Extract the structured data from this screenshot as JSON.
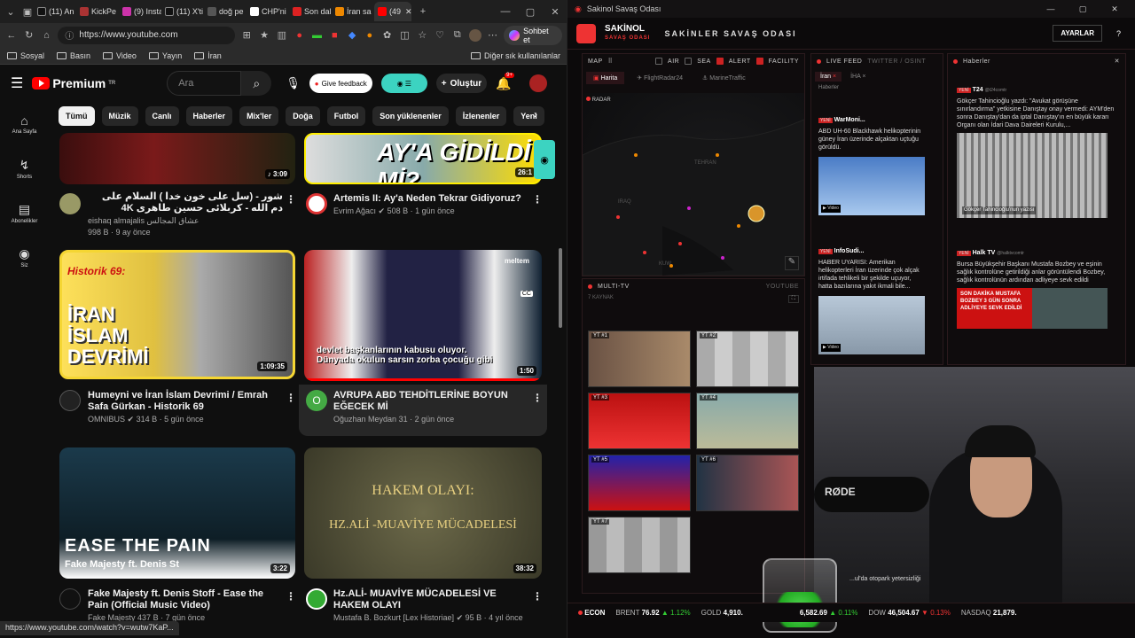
{
  "browser": {
    "tabs": [
      "(11) An",
      "KickPe",
      "(9) Insta",
      "(11) X'ti",
      "doğ pe",
      "CHP'ni",
      "Son dal",
      "İran sa",
      "(49"
    ],
    "address": "https://www.youtube.com",
    "profile_button": "Sohbet et",
    "bookmarks": [
      "Sosyal",
      "Basın",
      "Video",
      "Yayın",
      "İran"
    ],
    "bookmarks_other": "Diğer sık kullanılanlar",
    "status_url": "https://www.youtube.com/watch?v=wutw7KaP..."
  },
  "youtube": {
    "brand": "Premium",
    "brand_region": "TR",
    "search_placeholder": "Ara",
    "feedback": "Give feedback",
    "create": "Oluştur",
    "notif_count": "9+",
    "sidebar": [
      "Ana Sayfa",
      "Shorts",
      "Abonelikler",
      "Siz"
    ],
    "chips": [
      "Tümü",
      "Müzik",
      "Canlı",
      "Haberler",
      "Mix'ler",
      "Doğa",
      "Futbol",
      "Son yüklenenler",
      "İzlenenler",
      "Yeni"
    ],
    "videos": [
      {
        "title": "شور - (سل علی خون خدا ) السلام علی دم الله - کربلائی حسین طاهری 4K",
        "channel": "eishaq almajalis عشاق المجالس",
        "meta": "998 B · 9 ay önce",
        "duration": "3:09"
      },
      {
        "title": "Artemis II: Ay'a Neden Tekrar Gidiyoruz?",
        "channel": "Evrim Ağacı",
        "meta": "508 B · 1 gün önce",
        "duration": "26:1",
        "thumb_text": "AY'A GİDİLDİ Mİ?"
      },
      {
        "title": "Humeyni ve İran İslam Devrimi / Emrah Safa Gürkan - Historik 69",
        "channel": "OMNIBUS",
        "meta": "314 B · 5 gün önce",
        "duration": "1:09:35",
        "thumb_tag": "Historik 69:",
        "thumb_text": "İRAN İSLAM DEVRİMİ"
      },
      {
        "title": "AVRUPA ABD TEHDİTLERİNE BOYUN EĞECEK Mİ",
        "channel": "Oğuzhan Meydan",
        "meta": "31 · 2 gün önce",
        "duration": "1:50",
        "thumb_caption_1": "devlet başkanlarının kabusu oluyor.",
        "thumb_caption_2": "Dünyada okulun sarsın zorba çocuğu gibi",
        "thumb_logo": "meltem",
        "cc": "CC"
      },
      {
        "title": "Fake Majesty ft. Denis Stoff - Ease the Pain (Official Music Video)",
        "channel": "Fake Majesty",
        "meta": "437 B · 7 gün önce",
        "duration": "3:22",
        "thumb_text": "EASE THE PAIN",
        "thumb_sub": "Fake Majesty ft. Denis St"
      },
      {
        "title": "Hz.ALİ- MUAVİYE MÜCADELESİ VE HAKEM OLAYI",
        "channel": "Mustafa B. Bozkurt [Lex Historiae]",
        "meta": "95 B · 4 yıl önce",
        "duration": "38:32",
        "thumb_text": "HAKEM OLAYI:",
        "thumb_sub": "HZ.ALİ -MUAVİYE MÜCADELESİ"
      }
    ],
    "avatar_initial": "O"
  },
  "app": {
    "window_title": "Sakinol Savaş Odası",
    "brand": "SAKİNOL",
    "brand_sub": "SAVAŞ ODASI",
    "header_title": "SAKİNLER SAVAŞ ODASI",
    "settings": "AYARLAR",
    "help": "?",
    "map_label": "MAP",
    "map_filters": [
      "AIR",
      "SEA",
      "ALERT",
      "FACILITY"
    ],
    "map_tabs": [
      "Harita",
      "FlightRadar24",
      "MarineTraffic"
    ],
    "radar": "RADAR",
    "cities": [
      "TEHRAN",
      "IRAQ",
      "KUW"
    ],
    "live_feed": "LIVE FEED",
    "twitter_osint": "TWITTER / OSINT",
    "feed_tabs": [
      "İran",
      "İHA"
    ],
    "feed_sub": "Haberler",
    "feed_items": [
      {
        "badge": "YENİ",
        "src": "WarMoni...",
        "text": "ABD UH-60 Blackhawk helikopterinin güney İran üzerinde alçaktan uçtuğu görüldü.",
        "video": "Video"
      },
      {
        "badge": "YENİ",
        "src": "InfoSudi...",
        "text": "HABER UYARISI: Amerikan helikopterleri İran üzerinde çok alçak irtifada tehlikeli bir şekilde uçuyor, hatta bazılarına yakıt ikmali bile...",
        "video": "Video"
      }
    ],
    "news_label": "Haberler",
    "news_items": [
      {
        "badge": "YENİ",
        "src": "T24",
        "handle": "@t24comtr",
        "text": "Gökçer Tahincioğlu yazdı: \"Avukat görüşüne sınırlandırma\" yetkisine Danıştay onay vermedi: AYM'den sonra Danıştay'dan da iptal Danıştay'ın en büyük kararı Organı olan İdari Dava Daireleri Kurulu,...",
        "caption": "Gökçer Tahincioğlu'nun yazısı"
      },
      {
        "badge": "YENİ",
        "src": "Halk TV",
        "handle": "@halktvcomtr",
        "text": "Bursa Büyükşehir Başkanı Mustafa Bozbey ve eşinin sağlık kontrolüne getirildiği anlar görüntülendi Bozbey, sağlık kontrolünün ardından adliyeye sevk edildi",
        "banner": "SON DAKİKA MUSTAFA BOZBEY 3 GÜN SONRA ADLİYEYE SEVK EDİLDİ"
      }
    ],
    "multi_tv": "MULTI-TV",
    "youtube": "YOUTUBE",
    "multi_sub": "7 KAYNAK",
    "tv_labels": [
      "YT #1",
      "YT #2",
      "YT #3",
      "YT #4",
      "YT #5",
      "YT #6",
      "YT #7"
    ],
    "ticker_label": "ECON",
    "ticker": [
      {
        "name": "BRENT",
        "value": "76.92",
        "chg": "▲ 1.12%"
      },
      {
        "name": "GOLD",
        "value": "4,910.",
        "chg": ""
      },
      {
        "name": "",
        "value": "6,582.69",
        "chg": "▲ 0.11%"
      },
      {
        "name": "DOW",
        "value": "46,504.67",
        "chg": "▼ 0.13%"
      },
      {
        "name": "NASDAQ",
        "value": "21,879.",
        "chg": ""
      }
    ],
    "overlay_text": "...ul'da otopark yetersizliği",
    "mic_brand": "RØDE"
  }
}
